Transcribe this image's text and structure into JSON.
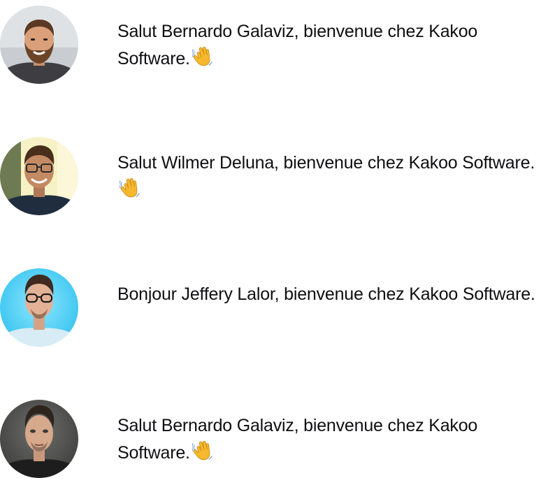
{
  "greetings": [
    {
      "message": "Salut Bernardo Galaviz, bienvenue chez Kakoo Software.",
      "emoji": "waving-hand",
      "avatar": "bearded-man-portrait"
    },
    {
      "message": "Salut Wilmer Deluna, bienvenue chez Kakoo Software.",
      "emoji": "waving-hand",
      "avatar": "man-with-glasses-portrait"
    },
    {
      "message": "Bonjour Jeffery Lalor, bienvenue chez Kakoo Software.",
      "emoji": "",
      "avatar": "man-with-glasses-blue-background-portrait"
    },
    {
      "message": "Salut Bernardo Galaviz, bienvenue chez Kakoo Software.",
      "emoji": "waving-hand",
      "avatar": "man-dark-background-portrait"
    }
  ],
  "colors": {
    "text": "#0f0f12",
    "background": "#ffffff",
    "wave": "#f5b82e"
  }
}
